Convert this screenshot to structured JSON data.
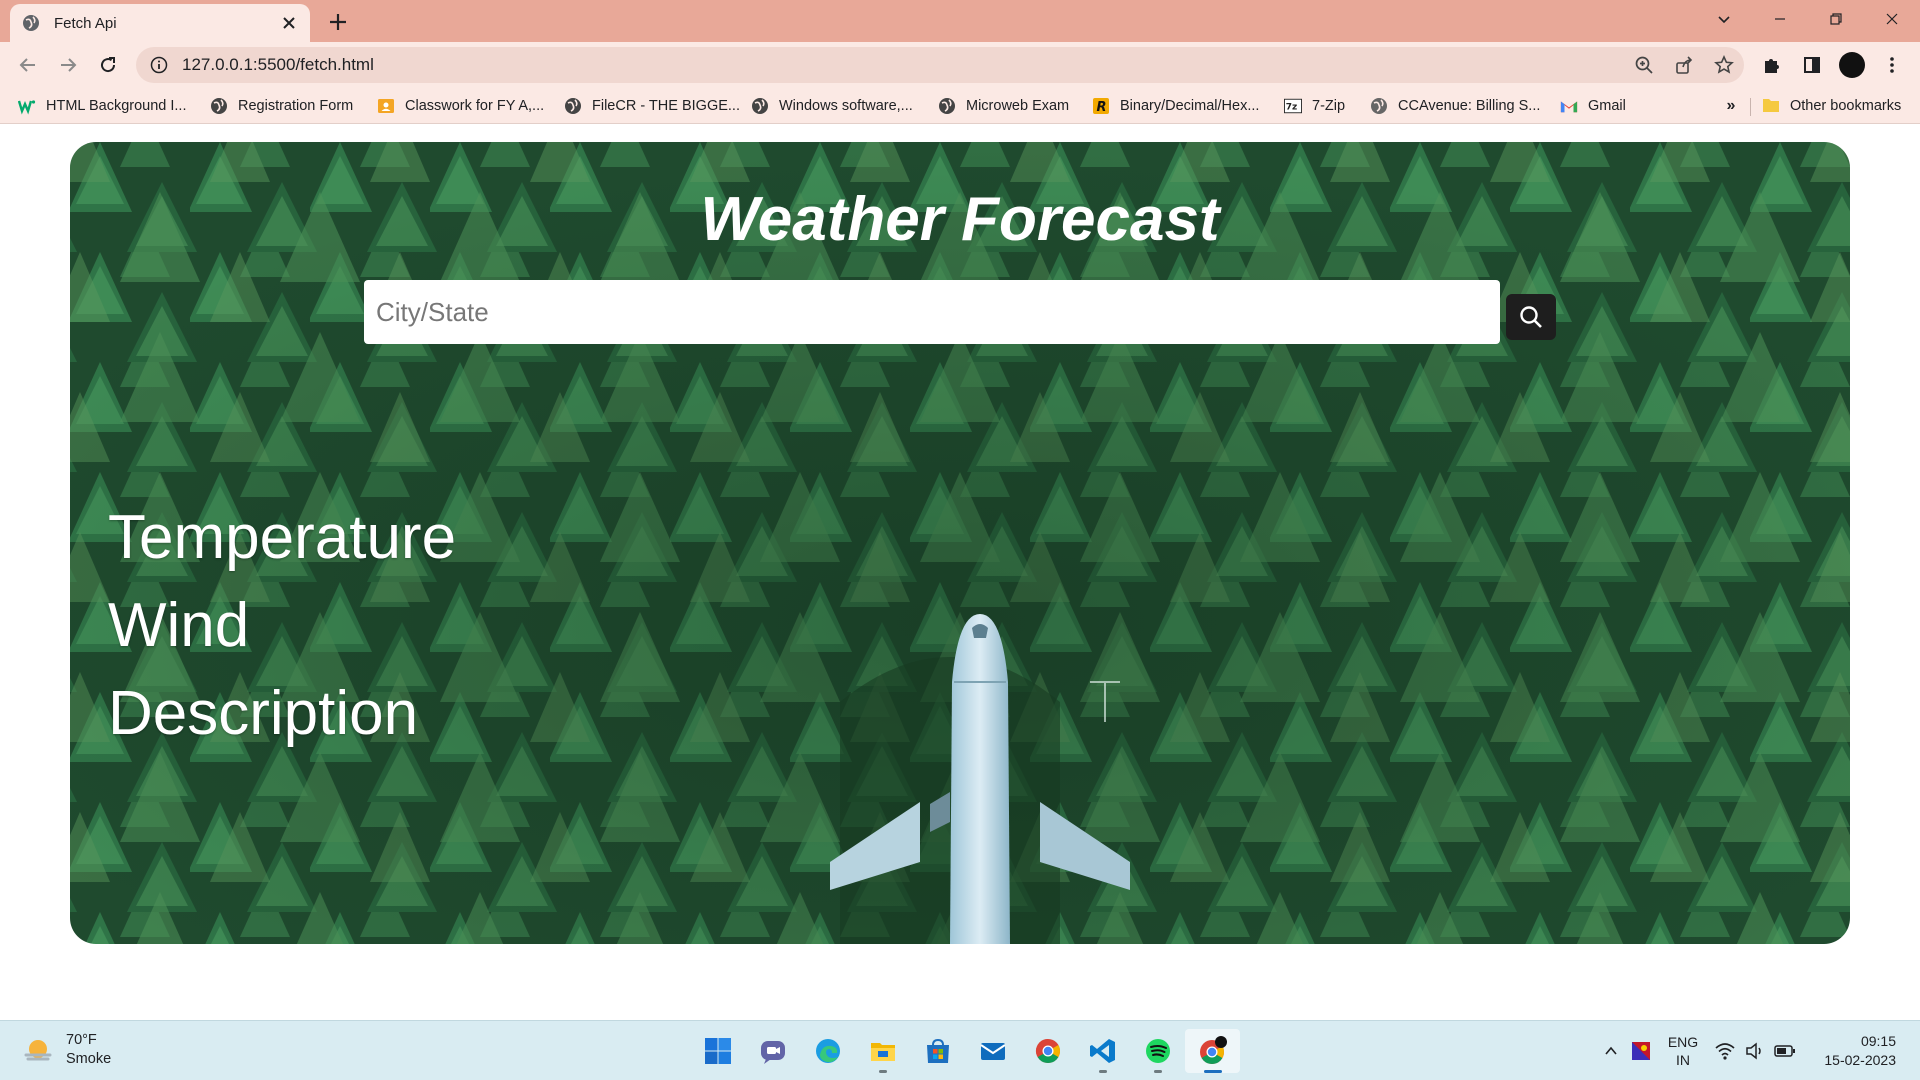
{
  "browser": {
    "tab": {
      "title": "Fetch Api"
    },
    "url": "127.0.0.1:5500/fetch.html"
  },
  "bookmarks": {
    "items": [
      {
        "label": "HTML Background I...",
        "icon": "w3schools-icon"
      },
      {
        "label": "Registration Form",
        "icon": "globe-icon"
      },
      {
        "label": "Classwork for FY A,...",
        "icon": "classroom-icon"
      },
      {
        "label": "FileCR - THE BIGGE...",
        "icon": "globe-icon"
      },
      {
        "label": "Windows software,...",
        "icon": "globe-icon"
      },
      {
        "label": "Microweb Exam",
        "icon": "globe-icon"
      },
      {
        "label": "Binary/Decimal/Hex...",
        "icon": "r-icon"
      },
      {
        "label": "7-Zip",
        "icon": "7zip-icon"
      },
      {
        "label": "CCAvenue: Billing S...",
        "icon": "globe-icon"
      },
      {
        "label": "Gmail",
        "icon": "gmail-icon"
      }
    ],
    "more": "»",
    "other": "Other bookmarks"
  },
  "app": {
    "title": "Weather Forecast",
    "search": {
      "placeholder": "City/State",
      "value": ""
    },
    "readings": {
      "temperature": "Temperature",
      "wind": "Wind",
      "description": "Description"
    }
  },
  "taskbar": {
    "weather": {
      "temp": "70°F",
      "condition": "Smoke"
    },
    "apps": [
      "windows-start-icon",
      "teams-chat-icon",
      "edge-icon",
      "file-explorer-icon",
      "microsoft-store-icon",
      "mail-icon",
      "chrome-icon",
      "vscode-icon",
      "spotify-icon",
      "chrome-active-icon"
    ],
    "language": {
      "line1": "ENG",
      "line2": "IN"
    },
    "clock": {
      "time": "09:15",
      "date": "15-02-2023"
    }
  },
  "colors": {
    "tabstrip": "#e8a898",
    "toolbar": "#fbe9e4",
    "search_button": "#1e1e1e",
    "taskbar": "#d9ecf2"
  }
}
